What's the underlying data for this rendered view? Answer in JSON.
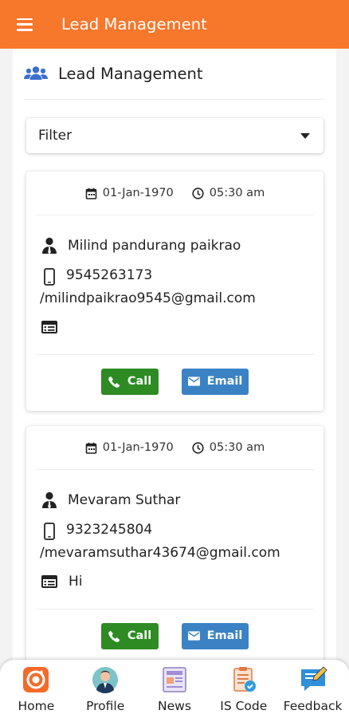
{
  "appbar": {
    "title": "Lead Management"
  },
  "section": {
    "title": "Lead Management"
  },
  "filter": {
    "label": "Filter"
  },
  "leads": [
    {
      "date": "01-Jan-1970",
      "time": "05:30 am",
      "name": "Milind pandurang paikrao",
      "phone": "9545263173",
      "email": "/milindpaikrao9545@gmail.com",
      "message": "",
      "call_label": "Call",
      "email_label": "Email"
    },
    {
      "date": "01-Jan-1970",
      "time": "05:30 am",
      "name": "Mevaram Suthar",
      "phone": "9323245804",
      "email": "/mevaramsuthar43674@gmail.com",
      "message": "Hi",
      "call_label": "Call",
      "email_label": "Email"
    }
  ],
  "bottom_nav": [
    {
      "label": "Home",
      "icon": "home-logo-icon"
    },
    {
      "label": "Profile",
      "icon": "profile-avatar-icon"
    },
    {
      "label": "News",
      "icon": "news-icon"
    },
    {
      "label": "IS Code",
      "icon": "is-code-icon"
    },
    {
      "label": "Feedback",
      "icon": "feedback-icon"
    }
  ],
  "colors": {
    "appbar": "#f7772b",
    "call_button": "#2e8b23",
    "email_button": "#3b82c4",
    "section_icon": "#3b6fd0"
  }
}
